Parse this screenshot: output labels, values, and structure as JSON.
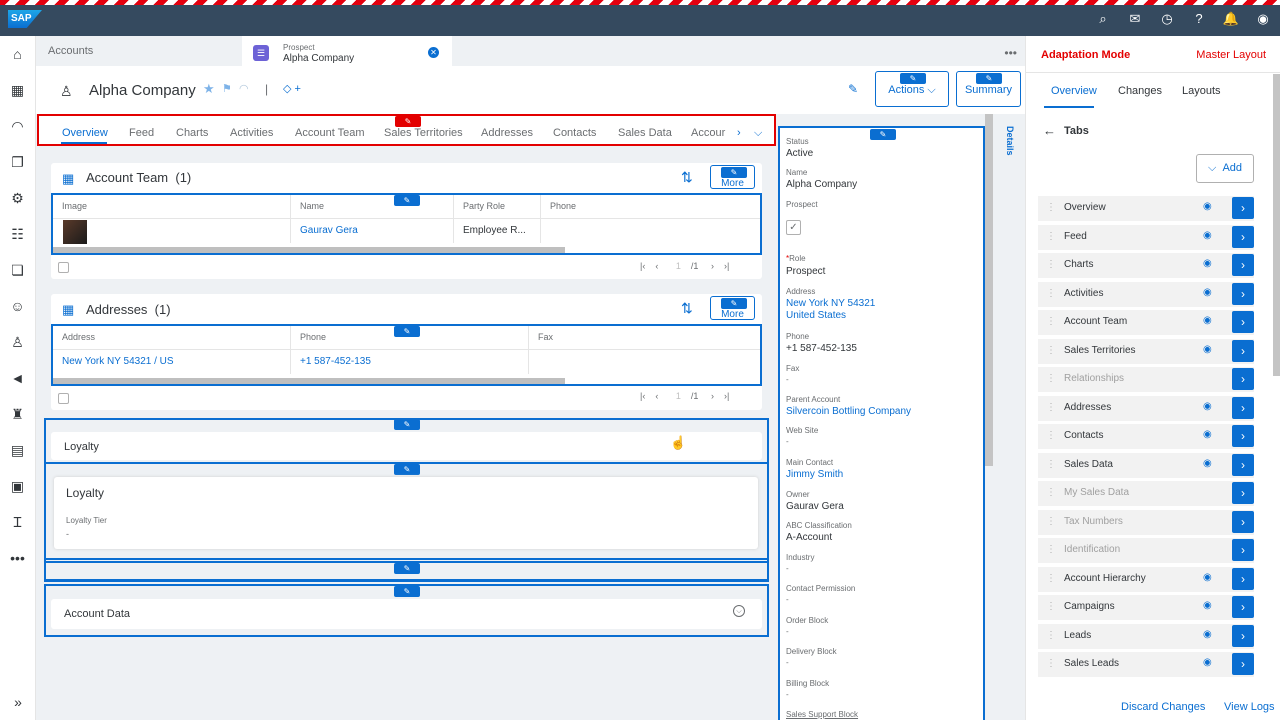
{
  "shell": {
    "logo": "SAP"
  },
  "sidenav": {
    "icons": [
      "home-icon",
      "calendar-icon",
      "feed-icon",
      "documents-icon",
      "settings-icon",
      "team-icon",
      "copy-icon",
      "people-icon",
      "person-icon",
      "megaphone-icon",
      "org-icon",
      "clipboard-icon",
      "qr-icon",
      "tool-icon"
    ],
    "more": "•••",
    "expand": "»"
  },
  "tabbar": {
    "tab1": "Accounts",
    "tab2_sub": "Prospect",
    "tab2_title": "Alpha Company",
    "more": "•••"
  },
  "header": {
    "title": "Alpha Company",
    "tag_plus": "+",
    "actions": "Actions",
    "summary": "Summary"
  },
  "objtabs": [
    "Overview",
    "Feed",
    "Charts",
    "Activities",
    "Account Team",
    "Sales Territories",
    "Addresses",
    "Contacts",
    "Sales Data",
    "Accour"
  ],
  "team": {
    "title": "Account Team",
    "count": "(1)",
    "more": "More",
    "cols": [
      "Image",
      "Name",
      "Party Role",
      "Phone"
    ],
    "name": "Gaurav Gera",
    "role": "Employee R...",
    "page_num": "1",
    "page_total": "/1"
  },
  "addr": {
    "title": "Addresses",
    "count": "(1)",
    "more": "More",
    "cols": [
      "Address",
      "Phone",
      "Fax"
    ],
    "address": "New York NY 54321 / US",
    "phone": "+1 587-452-135",
    "page_num": "1",
    "page_total": "/1"
  },
  "loyalty": {
    "outer": "Loyalty",
    "inner": "Loyalty",
    "tier_label": "Loyalty Tier",
    "tier_value": "-"
  },
  "account_data": {
    "title": "Account Data"
  },
  "details": {
    "tab": "Details",
    "status_l": "Status",
    "status_v": "Active",
    "name_l": "Name",
    "name_v": "Alpha Company",
    "prospect_l": "Prospect",
    "role_l": "Role",
    "role_v": "Prospect",
    "address_l": "Address",
    "address_v1": "New York NY 54321",
    "address_v2": "United States",
    "phone_l": "Phone",
    "phone_v": "+1 587-452-135",
    "fax_l": "Fax",
    "fax_v": "-",
    "parent_l": "Parent Account",
    "parent_v": "Silvercoin Bottling Company",
    "web_l": "Web Site",
    "web_v": "-",
    "contact_l": "Main Contact",
    "contact_v": "Jimmy Smith",
    "owner_l": "Owner",
    "owner_v": "Gaurav Gera",
    "abc_l": "ABC Classification",
    "abc_v": "A-Account",
    "industry_l": "Industry",
    "industry_v": "-",
    "cperm_l": "Contact Permission",
    "cperm_v": "-",
    "order_l": "Order Block",
    "order_v": "-",
    "delivery_l": "Delivery Block",
    "delivery_v": "-",
    "billing_l": "Billing Block",
    "billing_v": "-",
    "support_l": "Sales Support Block"
  },
  "panel": {
    "mode": "Adaptation Mode",
    "layout": "Master Layout",
    "tabs": [
      "Overview",
      "Changes",
      "Layouts"
    ],
    "heading": "Tabs",
    "add": "Add",
    "items": [
      {
        "label": "Overview",
        "visible": true
      },
      {
        "label": "Feed",
        "visible": true
      },
      {
        "label": "Charts",
        "visible": true
      },
      {
        "label": "Activities",
        "visible": true
      },
      {
        "label": "Account Team",
        "visible": true
      },
      {
        "label": "Sales Territories",
        "visible": true
      },
      {
        "label": "Relationships",
        "visible": false
      },
      {
        "label": "Addresses",
        "visible": true
      },
      {
        "label": "Contacts",
        "visible": true
      },
      {
        "label": "Sales Data",
        "visible": true
      },
      {
        "label": "My Sales Data",
        "visible": false
      },
      {
        "label": "Tax Numbers",
        "visible": false
      },
      {
        "label": "Identification",
        "visible": false
      },
      {
        "label": "Account Hierarchy",
        "visible": true
      },
      {
        "label": "Campaigns",
        "visible": true
      },
      {
        "label": "Leads",
        "visible": true
      },
      {
        "label": "Sales Leads",
        "visible": true
      }
    ],
    "discard": "Discard Changes",
    "logs": "View Logs"
  }
}
